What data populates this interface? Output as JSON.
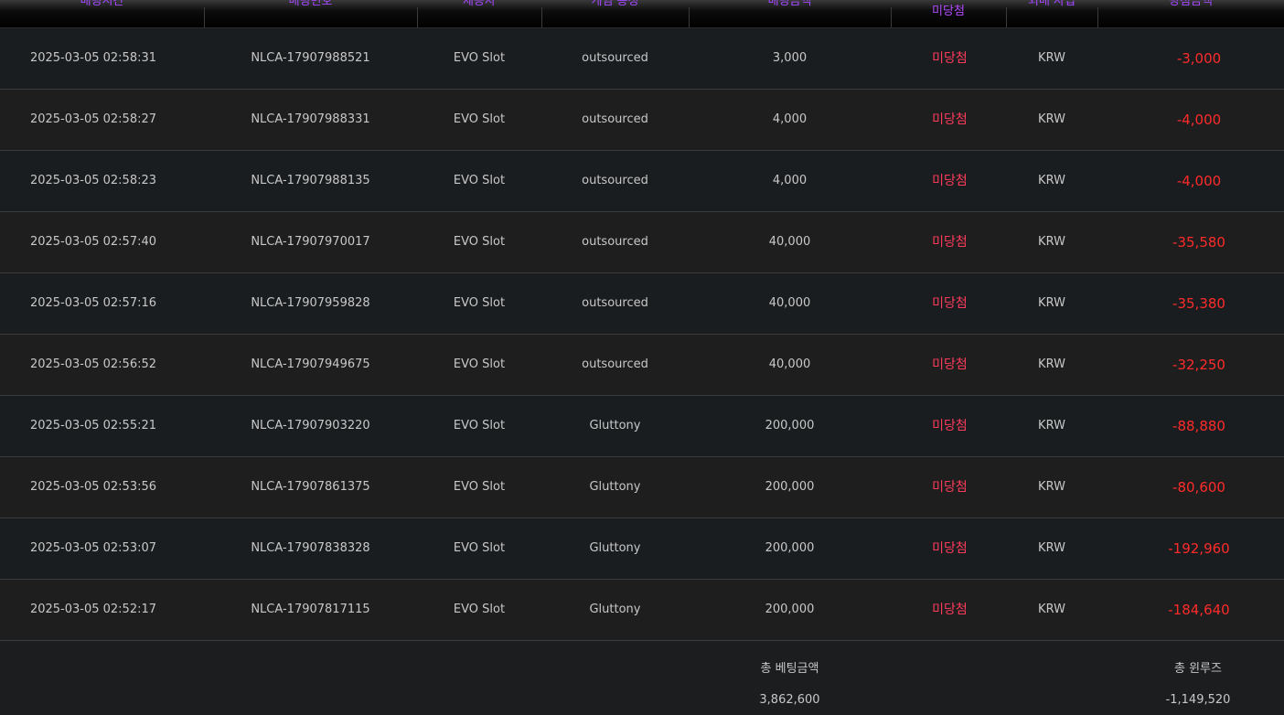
{
  "table": {
    "headers": [
      "배팅시간",
      "배팅번호",
      "제공사",
      "게임 종정",
      "배팅금액",
      "미당첨",
      "외배 사업",
      "당첨금액"
    ],
    "rows": [
      {
        "time": "2025-03-05 02:58:31",
        "bet_id": "NLCA-17907988521",
        "provider": "EVO Slot",
        "game": "outsourced",
        "amount": "3,000",
        "result": "미당첨",
        "currency": "KRW",
        "win": "-3,000"
      },
      {
        "time": "2025-03-05 02:58:27",
        "bet_id": "NLCA-17907988331",
        "provider": "EVO Slot",
        "game": "outsourced",
        "amount": "4,000",
        "result": "미당첨",
        "currency": "KRW",
        "win": "-4,000"
      },
      {
        "time": "2025-03-05 02:58:23",
        "bet_id": "NLCA-17907988135",
        "provider": "EVO Slot",
        "game": "outsourced",
        "amount": "4,000",
        "result": "미당첨",
        "currency": "KRW",
        "win": "-4,000"
      },
      {
        "time": "2025-03-05 02:57:40",
        "bet_id": "NLCA-17907970017",
        "provider": "EVO Slot",
        "game": "outsourced",
        "amount": "40,000",
        "result": "미당첨",
        "currency": "KRW",
        "win": "-35,580"
      },
      {
        "time": "2025-03-05 02:57:16",
        "bet_id": "NLCA-17907959828",
        "provider": "EVO Slot",
        "game": "outsourced",
        "amount": "40,000",
        "result": "미당첨",
        "currency": "KRW",
        "win": "-35,380"
      },
      {
        "time": "2025-03-05 02:56:52",
        "bet_id": "NLCA-17907949675",
        "provider": "EVO Slot",
        "game": "outsourced",
        "amount": "40,000",
        "result": "미당첨",
        "currency": "KRW",
        "win": "-32,250"
      },
      {
        "time": "2025-03-05 02:55:21",
        "bet_id": "NLCA-17907903220",
        "provider": "EVO Slot",
        "game": "Gluttony",
        "amount": "200,000",
        "result": "미당첨",
        "currency": "KRW",
        "win": "-88,880"
      },
      {
        "time": "2025-03-05 02:53:56",
        "bet_id": "NLCA-17907861375",
        "provider": "EVO Slot",
        "game": "Gluttony",
        "amount": "200,000",
        "result": "미당첨",
        "currency": "KRW",
        "win": "-80,600"
      },
      {
        "time": "2025-03-05 02:53:07",
        "bet_id": "NLCA-17907838328",
        "provider": "EVO Slot",
        "game": "Gluttony",
        "amount": "200,000",
        "result": "미당첨",
        "currency": "KRW",
        "win": "-192,960"
      },
      {
        "time": "2025-03-05 02:52:17",
        "bet_id": "NLCA-17907817115",
        "provider": "EVO Slot",
        "game": "Gluttony",
        "amount": "200,000",
        "result": "미당첨",
        "currency": "KRW",
        "win": "-184,640"
      }
    ]
  },
  "totals": {
    "bet_label": "총 베팅금액",
    "bet_value": "3,862,600",
    "win_label": "총 윈루즈",
    "win_value": "-1,149,520"
  }
}
